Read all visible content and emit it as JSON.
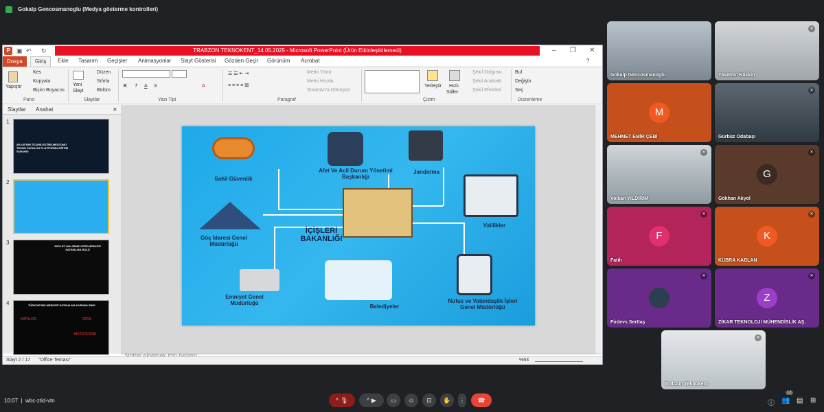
{
  "presenter_bar": {
    "text": "Gokalp Gencosmanoglu (Medya gösterme kontrolleri)"
  },
  "ppt": {
    "window_title": "TRABZON TEKNOKENT_14.05.2025  -  Microsoft PowerPoint (Ürün Etkinleştirilemedi)",
    "tabs": [
      "Dosya",
      "Giriş",
      "Ekle",
      "Tasarım",
      "Geçişler",
      "Animasyonlar",
      "Slayt Gösterisi",
      "Gözden Geçir",
      "Görünüm",
      "Acrobat"
    ],
    "ribbon": {
      "pano": {
        "paste": "Yapıştır",
        "cut": "Kes",
        "copy": "Kopyala",
        "format_painter": "Biçim Boyacısı",
        "group": "Pano"
      },
      "slaytlar": {
        "new": "Yeni",
        "new2": "Slayt",
        "layout": "Düzen",
        "reset": "Sıfırla",
        "section": "Bölüm",
        "group": "Slaytlar"
      },
      "font": {
        "group": "Yazı Tipi"
      },
      "paragraf": {
        "dir": "Metin Yönü",
        "align": "Metni Hizala",
        "smartart": "SmartArt'a Dönüştür",
        "group": "Paragraf"
      },
      "cizim": {
        "arrange": "Yerleştir",
        "styles": "Hızlı",
        "styles2": "Stiller",
        "fill": "Şekil Dolgusu",
        "outline": "Şekil Anahattı",
        "effects": "Şekil Efektleri",
        "group": "Çizim"
      },
      "duzenleme": {
        "find": "Bul",
        "replace": "Değiştir",
        "select": "Seç",
        "group": "Düzenleme"
      }
    },
    "pane_tabs": [
      "Slaytlar",
      "Anahat"
    ],
    "thumbs": [
      {
        "num": "1",
        "text": "AR-GE'NİN TİCARİLEŞTİRİLMESİ DMO TEKNO KATALOG PLATFORMU EĞİTİM SUNUMU"
      },
      {
        "num": "2",
        "text": ""
      },
      {
        "num": "3",
        "text": "DEVLET MALZEME OFİSİ MERKEZİ SATINALMA ROLÜ"
      },
      {
        "num": "4",
        "text": "TÜRKİYE'NİN MERKEZİ SATINALMA KURUMU DMO"
      }
    ],
    "thumb4": {
      "katalog": "KATALOG",
      "stok": "STOK",
      "mutferik": "MÜTEFERRİK"
    },
    "slide_labels": {
      "sahil": "Sahil Güvenlik",
      "afet": "Afet Ve Acil Durum Yönetimi Başkanlığı",
      "jandarma": "Jandarma",
      "valilikler": "Valilikler",
      "goc": "Göç İdaresi Genel Müdürlüğü",
      "icisleri": "İÇİŞLERİ BAKANLIĞI",
      "emniyet": "Emniyet Genel Müdürlüğü",
      "belediyeler": "Belediyeler",
      "nufus": "Nüfus ve Vatandaşlık İşleri Genel Müdürlüğü"
    },
    "notes_placeholder": "Notlar eklemek için tıklatın",
    "status": {
      "slide": "Slayt 2 / 17",
      "theme": "\"Office Teması\"",
      "zoom": "%63"
    }
  },
  "participants": [
    {
      "name": "Gokalp Gencosmanoglu",
      "kind": "photo1"
    },
    {
      "name": "Yasemin Kaskin",
      "kind": "photo2"
    },
    {
      "name": "MEHMET EMİR ÇEBİ",
      "kind": "orange",
      "initial": "M"
    },
    {
      "name": "Gürbüz Odabaşı",
      "kind": "photo3"
    },
    {
      "name": "Volkan YILDIRIM",
      "kind": "photo4"
    },
    {
      "name": "Gökhan Akyol",
      "kind": "brown",
      "initial": "G"
    },
    {
      "name": "Fatih",
      "kind": "magenta",
      "initial": "F"
    },
    {
      "name": "KÜBRA KABLAN",
      "kind": "orange",
      "initial": "K"
    },
    {
      "name": "Firdevs Serttaş",
      "kind": "purple"
    },
    {
      "name": "ZİKAR TEKNOLOJİ MÜHENDİSLİK AŞ.",
      "kind": "purple",
      "initial": "Z"
    },
    {
      "name": "Trabzon Teknokent",
      "kind": "photo5"
    }
  ],
  "bottom": {
    "time": "10:07",
    "separator": "|",
    "meeting_code": "wbc-ztid-vtn",
    "people_count": "12"
  }
}
